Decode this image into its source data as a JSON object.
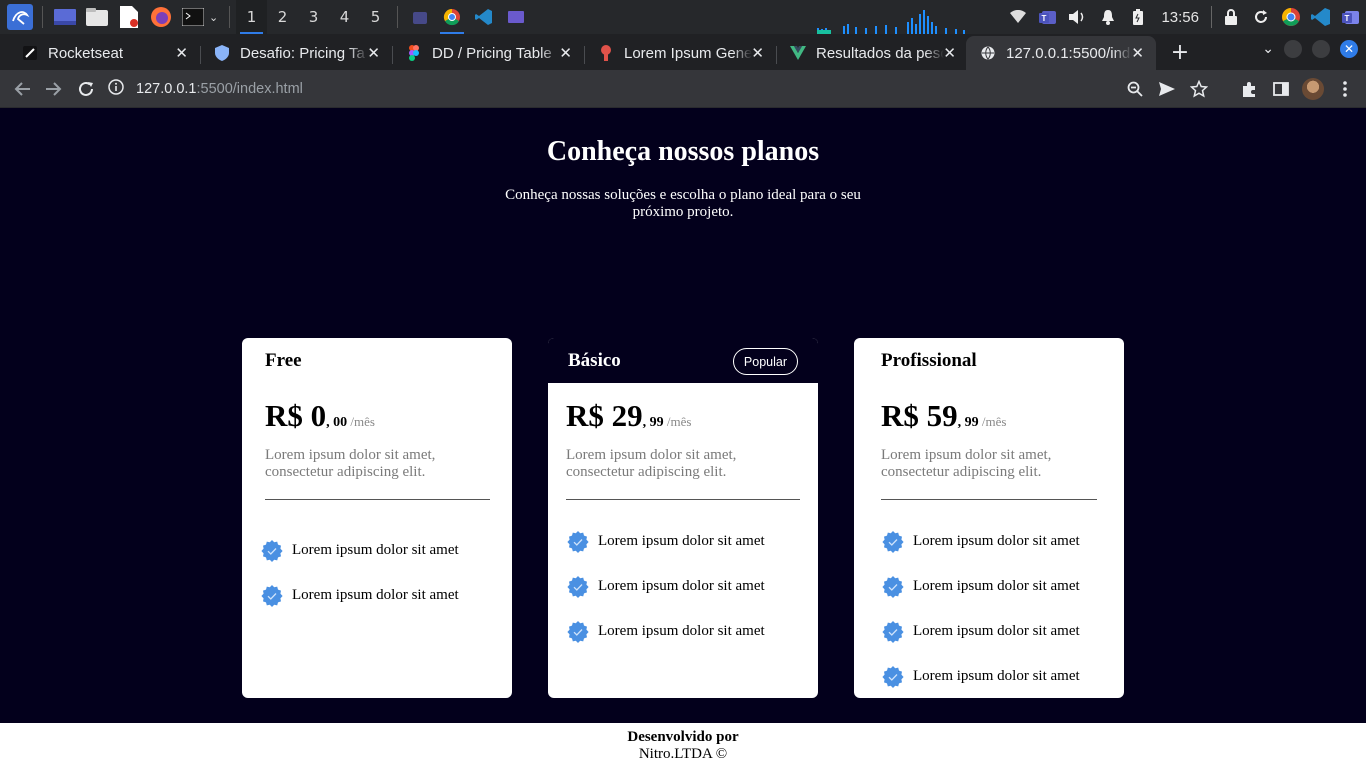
{
  "taskbar": {
    "workspaces": [
      "1",
      "2",
      "3",
      "4",
      "5"
    ],
    "active_workspace": "1",
    "clock": "13:56",
    "icons": [
      "kali-menu-icon",
      "show-desktop-icon",
      "file-manager-icon",
      "text-editor-icon",
      "firefox-icon",
      "terminal-icon",
      "teams-icon",
      "chrome-icon",
      "vscode-icon",
      "app-icon"
    ],
    "tray_icons": [
      "network-icon",
      "teams-icon",
      "volume-icon",
      "notifications-icon",
      "battery-icon",
      "lock-icon",
      "refresh-icon",
      "chrome-icon",
      "vscode-icon",
      "teams-icon"
    ]
  },
  "browser": {
    "tabs": [
      {
        "title": "Rocketseat",
        "icon": "rocketseat-icon"
      },
      {
        "title": "Desafio: Pricing Ta",
        "icon": "shield-icon"
      },
      {
        "title": "DD / Pricing Table",
        "icon": "figma-icon"
      },
      {
        "title": "Lorem Ipsum Gene",
        "icon": "lorem-icon"
      },
      {
        "title": "Resultados da peso",
        "icon": "vue-icon"
      },
      {
        "title": "127.0.0.1:5500/inde",
        "icon": "globe-icon"
      }
    ],
    "active_tab": 5,
    "url_host": "127.0.0.1",
    "url_path": ":5500/index.html",
    "accent": "#2f7ce8"
  },
  "page": {
    "title": "Conheça nossos planos",
    "subtitle": "Conheça nossas soluções e escolha o plano ideal para o seu próximo projeto.",
    "plans": [
      {
        "name": "Free",
        "price_main": "R$ 0",
        "price_cents": ", 00",
        "period": " /mês",
        "description": "Lorem ipsum dolor sit amet, consectetur adipiscing elit.",
        "features": [
          "Lorem ipsum dolor sit amet",
          "Lorem ipsum dolor sit amet"
        ]
      },
      {
        "name": "Básico",
        "badge": "Popular",
        "price_main": "R$ 29",
        "price_cents": ", 99",
        "period": " /mês",
        "description": "Lorem ipsum dolor sit amet, consectetur adipiscing elit.",
        "features": [
          "Lorem ipsum dolor sit amet",
          "Lorem ipsum dolor sit amet",
          "Lorem ipsum dolor sit amet"
        ]
      },
      {
        "name": "Profissional",
        "price_main": "R$ 59",
        "price_cents": ", 99",
        "period": " /mês",
        "description": "Lorem ipsum dolor sit amet, consectetur adipiscing elit.",
        "features": [
          "Lorem ipsum dolor sit amet",
          "Lorem ipsum dolor sit amet",
          "Lorem ipsum dolor sit amet",
          "Lorem ipsum dolor sit amet"
        ]
      }
    ],
    "footer_line1": "Desenvolvido por",
    "footer_line2": "Nitro.LTDA ©",
    "colors": {
      "background": "#03001c",
      "check": "#4a90e2",
      "card": "#ffffff"
    }
  }
}
